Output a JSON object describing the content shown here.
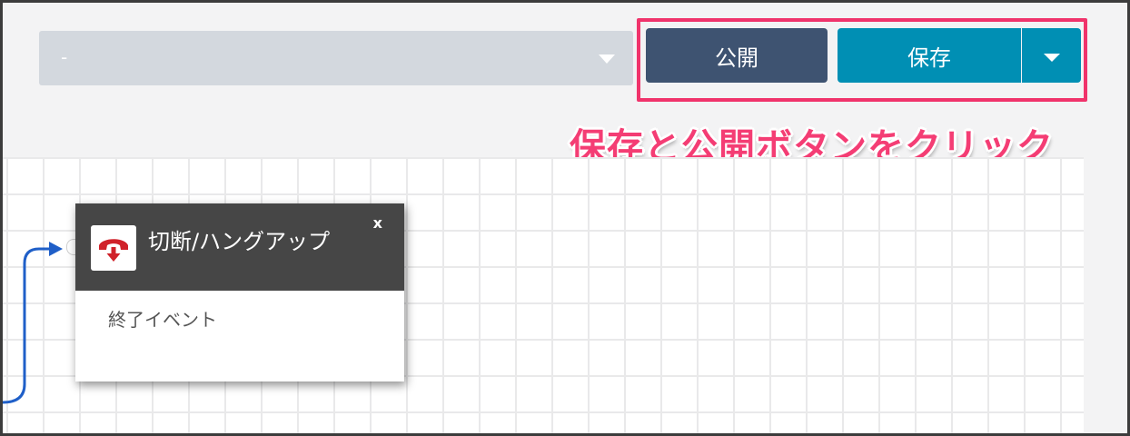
{
  "toolbar": {
    "version_select_value": "-",
    "publish_label": "公開",
    "save_label": "保存"
  },
  "annotation": {
    "text": "保存と公開ボタンをクリック",
    "color": "#f43d74"
  },
  "flow_block": {
    "title": "切断/ハングアップ",
    "close_label": "x",
    "body_text": "終了イベント",
    "icon": "hang-up-phone-icon"
  },
  "colors": {
    "publish_button": "#3e5371",
    "save_button": "#008fb4",
    "highlight_border": "#f0336b",
    "block_header": "#464646",
    "connector": "#1f5fc8",
    "hang_up_icon": "#d0222a"
  }
}
